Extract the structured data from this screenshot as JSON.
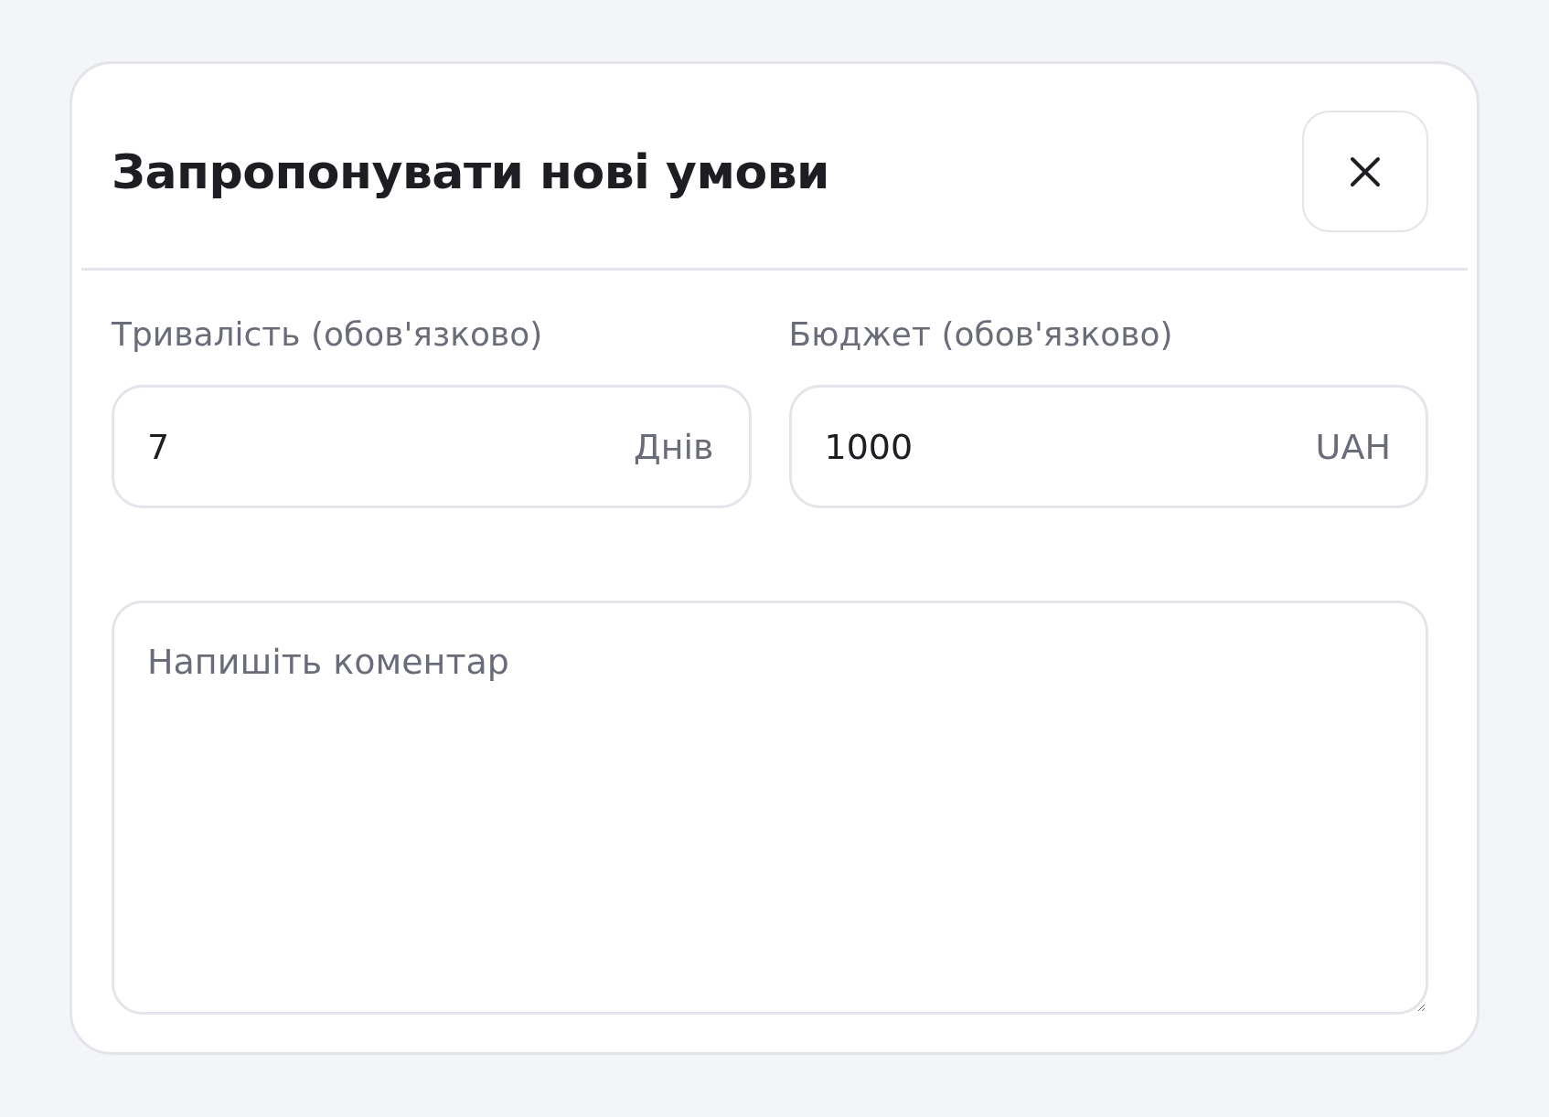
{
  "dialog": {
    "title": "Запропонувати нові умови"
  },
  "fields": [
    {
      "label": "Тривалість (обов'язково)",
      "value": "7",
      "unit": "Днів"
    },
    {
      "label": "Бюджет (обов'язково)",
      "value": "1000",
      "unit": "UAH"
    }
  ],
  "comment": {
    "placeholder": "Напишіть коментар"
  }
}
